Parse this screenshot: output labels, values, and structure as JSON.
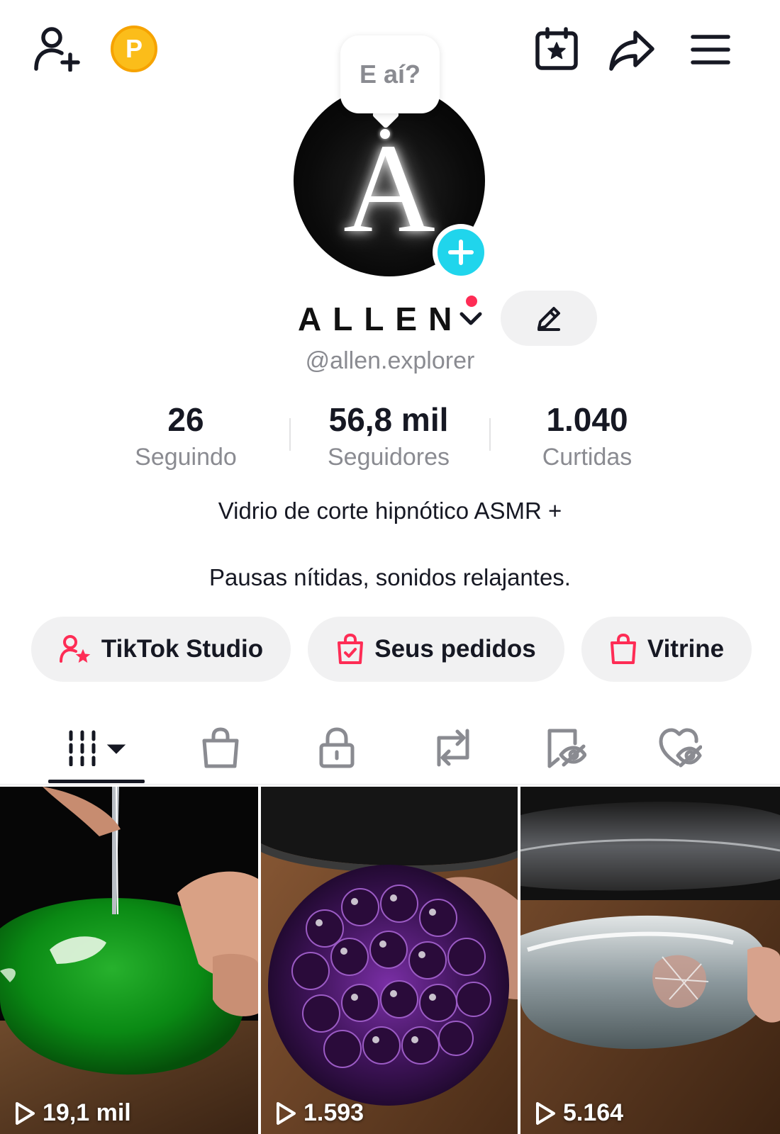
{
  "header": {
    "icons": [
      "add-friend-icon",
      "coin-icon",
      "calendar-star-icon",
      "share-icon",
      "menu-icon"
    ],
    "coin_letter": "P"
  },
  "profile": {
    "avatar_letter": "A",
    "bubble_text": "E aí?",
    "name": "ALLEN",
    "handle": "@allen.explorer"
  },
  "stats": [
    {
      "value": "26",
      "label": "Seguindo"
    },
    {
      "value": "56,8 mil",
      "label": "Seguidores"
    },
    {
      "value": "1.040",
      "label": "Curtidas"
    }
  ],
  "bio": {
    "line1": "Vidrio de corte hipnótico ASMR +",
    "line2": "Pausas nítidas, sonidos relajantes."
  },
  "actions": [
    {
      "label": "TikTok Studio",
      "icon": "creator-star-icon"
    },
    {
      "label": "Seus pedidos",
      "icon": "order-bag-icon"
    },
    {
      "label": "Vitrine",
      "icon": "shopping-bag-icon"
    }
  ],
  "tabs": [
    "videos-grid-icon",
    "shop-bag-icon",
    "lock-icon",
    "repost-icon",
    "favorites-hidden-icon",
    "liked-hidden-icon"
  ],
  "videos": [
    {
      "views": "19,1 mil"
    },
    {
      "views": "1.593"
    },
    {
      "views": "5.164"
    }
  ],
  "colors": {
    "accent_red": "#fe2c55",
    "accent_cyan": "#20d5ec",
    "coin": "#fbbd1a",
    "text_primary": "#161823",
    "text_secondary": "#8a8b91"
  }
}
